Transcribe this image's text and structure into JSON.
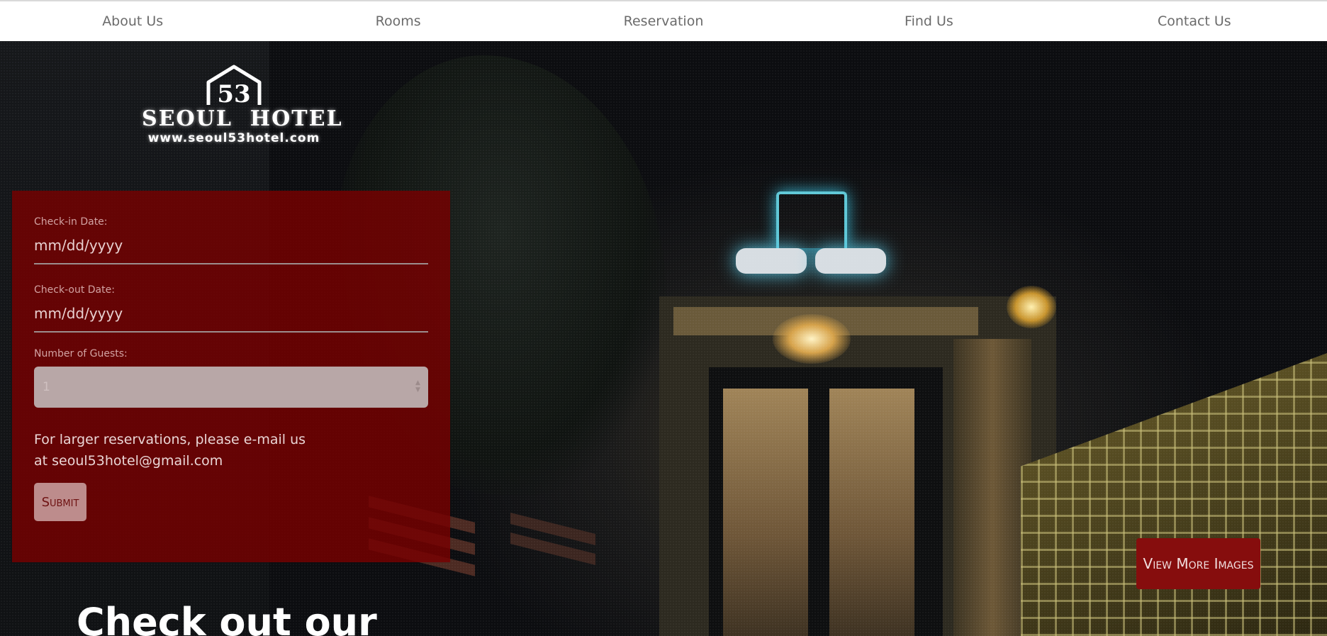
{
  "nav": {
    "items": [
      {
        "label": "About Us"
      },
      {
        "label": "Rooms"
      },
      {
        "label": "Reservation"
      },
      {
        "label": "Find Us"
      },
      {
        "label": "Contact Us"
      }
    ]
  },
  "logo": {
    "number": "53",
    "name": "SEOUL  HOTEL",
    "url": "www.seoul53hotel.com"
  },
  "form": {
    "checkin_label": "Check-in Date:",
    "checkin_placeholder": "mm/dd/yyyy",
    "checkout_label": "Check-out Date:",
    "checkout_placeholder": "mm/dd/yyyy",
    "guests_label": "Number of Guests:",
    "guests_value": "1",
    "note": "For larger reservations, please e-mail us at seoul53hotel@gmail.com",
    "submit_label": "Submit"
  },
  "gallery": {
    "view_more_label": "View More Images"
  },
  "section": {
    "heading": "Check out our"
  },
  "colors": {
    "nav_bg": "#ffffff",
    "form_bg": "#780000",
    "accent": "#860d0d"
  }
}
